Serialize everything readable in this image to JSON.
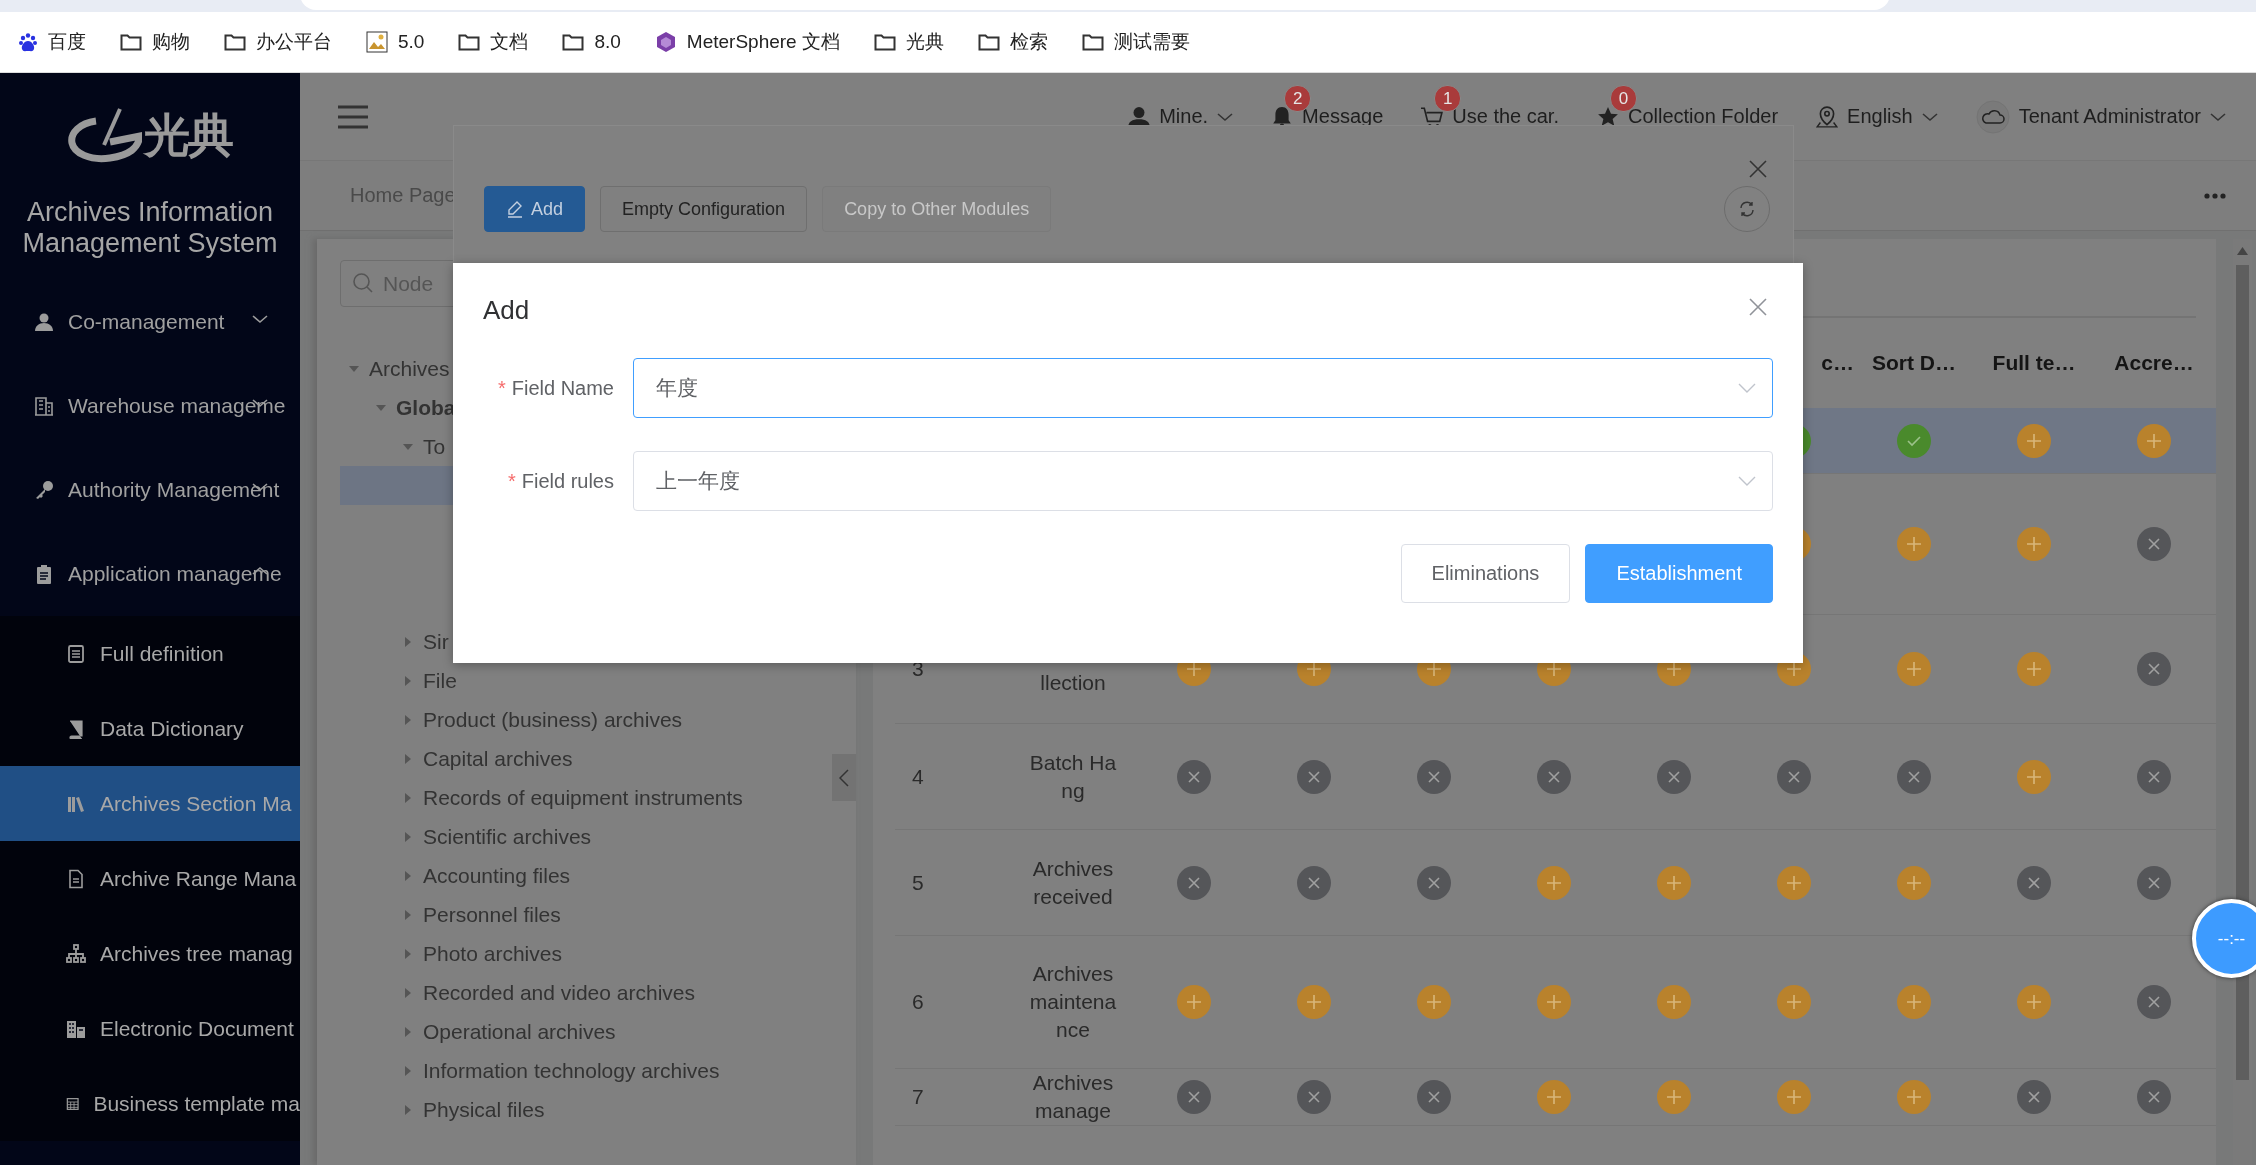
{
  "browser": {
    "bookmarks": [
      {
        "label": "百度"
      },
      {
        "label": "购物"
      },
      {
        "label": "办公平台"
      },
      {
        "label": "5.0"
      },
      {
        "label": "文档"
      },
      {
        "label": "8.0"
      },
      {
        "label": "MeterSphere 文档"
      },
      {
        "label": "光典"
      },
      {
        "label": "检索"
      },
      {
        "label": "测试需要"
      }
    ]
  },
  "sidebar": {
    "logo_text": "光典",
    "title": "Archives Information Management System",
    "menu": [
      {
        "label": "Co-management",
        "expanded": false
      },
      {
        "label": "Warehouse manageme",
        "expanded": false
      },
      {
        "label": "Authority Management",
        "expanded": false
      },
      {
        "label": "Application manageme",
        "expanded": true,
        "children": [
          {
            "label": "Full definition",
            "selected": false
          },
          {
            "label": "Data Dictionary",
            "selected": false
          },
          {
            "label": "Archives Section Ma",
            "selected": true
          },
          {
            "label": "Archive Range Mana",
            "selected": false
          },
          {
            "label": "Archives tree manag",
            "selected": false
          },
          {
            "label": "Electronic Document",
            "selected": false
          },
          {
            "label": "Business template ma",
            "selected": false
          }
        ]
      }
    ]
  },
  "header": {
    "items": [
      {
        "label": "Mine.",
        "dropdown": true
      },
      {
        "label": "Message",
        "badge": "2",
        "dropdown": false
      },
      {
        "label": "Use the car.",
        "badge": "1",
        "dropdown": false
      },
      {
        "label": "Collection Folder",
        "badge": "0",
        "dropdown": false
      },
      {
        "label": "English",
        "dropdown": true
      },
      {
        "label": "Tenant Administrator",
        "dropdown": true
      }
    ]
  },
  "tabs": [
    {
      "label": "Home Page",
      "selected": false
    }
  ],
  "tree": {
    "search": {
      "placeholder": "Node"
    },
    "nodes": [
      {
        "label": "Archives",
        "expanded": true,
        "selected": false,
        "children": [
          {
            "label": "Globa",
            "expanded": true,
            "selected": false,
            "children": [
              {
                "label": "To",
                "expanded": true,
                "selected": false,
                "children": [
                  {
                    "selected": true
                  }
                ]
              },
              {
                "label": "Sir",
                "expanded": false,
                "selected": false
              },
              {
                "label": "File",
                "expanded": false,
                "selected": false
              },
              {
                "label": "Product (business) archives",
                "expanded": false,
                "selected": false
              },
              {
                "label": "Capital archives",
                "expanded": false,
                "selected": false
              },
              {
                "label": "Records of equipment instruments",
                "expanded": false,
                "selected": false
              },
              {
                "label": "Scientific archives",
                "expanded": false,
                "selected": false
              },
              {
                "label": "Accounting files",
                "expanded": false,
                "selected": false
              },
              {
                "label": "Personnel files",
                "expanded": false,
                "selected": false
              },
              {
                "label": "Photo archives",
                "expanded": false,
                "selected": false
              },
              {
                "label": "Recorded and video archives",
                "expanded": false,
                "selected": false
              },
              {
                "label": "Operational archives",
                "expanded": false,
                "selected": false
              },
              {
                "label": "Information technology archives",
                "expanded": false,
                "selected": false
              },
              {
                "label": "Physical files",
                "expanded": false,
                "selected": false
              }
            ]
          }
        ]
      }
    ]
  },
  "table": {
    "columns": [
      {
        "label": "c…",
        "cut_left": true
      },
      {
        "label": "Sort D…",
        "cut_left": false
      },
      {
        "label": "Full te…",
        "cut_left": false
      },
      {
        "label": "Accre…",
        "cut_left": false
      }
    ],
    "rows": [
      {
        "selected": true,
        "cells": [
          null,
          null,
          null,
          null,
          null,
          {
            "kind": "check"
          },
          {
            "kind": "check"
          },
          {
            "kind": "plus"
          },
          {
            "kind": "plus"
          }
        ]
      },
      {
        "selected": false,
        "cells": [
          null,
          null,
          null,
          null,
          null,
          {
            "kind": "plus"
          },
          {
            "kind": "plus"
          },
          {
            "kind": "plus"
          },
          {
            "kind": "cross"
          }
        ]
      },
      {
        "number": "3",
        "name": "llection",
        "selected": false,
        "cells": [
          {
            "kind": "plus"
          },
          {
            "kind": "plus"
          },
          {
            "kind": "plus"
          },
          {
            "kind": "plus"
          },
          {
            "kind": "plus"
          },
          {
            "kind": "plus"
          },
          {
            "kind": "plus"
          },
          {
            "kind": "plus"
          },
          {
            "kind": "cross"
          }
        ]
      },
      {
        "number": "4",
        "name": "Batch Hang",
        "selected": false,
        "cells": [
          {
            "kind": "cross"
          },
          {
            "kind": "cross"
          },
          {
            "kind": "cross"
          },
          {
            "kind": "cross"
          },
          {
            "kind": "cross"
          },
          {
            "kind": "cross"
          },
          {
            "kind": "cross"
          },
          {
            "kind": "plus"
          },
          {
            "kind": "cross"
          }
        ]
      },
      {
        "number": "5",
        "name": "Archives received",
        "selected": false,
        "cells": [
          {
            "kind": "cross"
          },
          {
            "kind": "cross"
          },
          {
            "kind": "cross"
          },
          {
            "kind": "plus"
          },
          {
            "kind": "plus"
          },
          {
            "kind": "plus"
          },
          {
            "kind": "plus"
          },
          {
            "kind": "cross"
          },
          {
            "kind": "cross"
          }
        ]
      },
      {
        "number": "6",
        "name": "Archives maintenance",
        "selected": false,
        "cells": [
          {
            "kind": "plus"
          },
          {
            "kind": "plus"
          },
          {
            "kind": "plus"
          },
          {
            "kind": "plus"
          },
          {
            "kind": "plus"
          },
          {
            "kind": "plus"
          },
          {
            "kind": "plus"
          },
          {
            "kind": "plus"
          },
          {
            "kind": "cross"
          }
        ]
      },
      {
        "number": "7",
        "name": "Archives manage",
        "selected": false,
        "cells": [
          {
            "kind": "cross"
          },
          {
            "kind": "cross"
          },
          {
            "kind": "cross"
          },
          {
            "kind": "plus"
          },
          {
            "kind": "plus"
          },
          {
            "kind": "plus"
          },
          {
            "kind": "plus"
          },
          {
            "kind": "cross"
          },
          {
            "kind": "cross"
          }
        ]
      }
    ]
  },
  "config_dialog": {
    "buttons": [
      {
        "label": "Add",
        "kind": "primary",
        "disabled": false
      },
      {
        "label": "Empty Configuration",
        "kind": "default",
        "disabled": false
      },
      {
        "label": "Copy to Other Modules",
        "kind": "default",
        "disabled": true
      }
    ]
  },
  "add_dialog": {
    "title": "Add",
    "fields": [
      {
        "label": "Field Name",
        "required_mark": "*",
        "value": "年度",
        "focused": true
      },
      {
        "label": "Field rules",
        "required_mark": "*",
        "value": "上一年度",
        "focused": false
      }
    ],
    "buttons": [
      {
        "label": "Eliminations",
        "kind": "default"
      },
      {
        "label": "Establishment",
        "kind": "primary"
      }
    ]
  },
  "timer": {
    "text": "--:--"
  }
}
